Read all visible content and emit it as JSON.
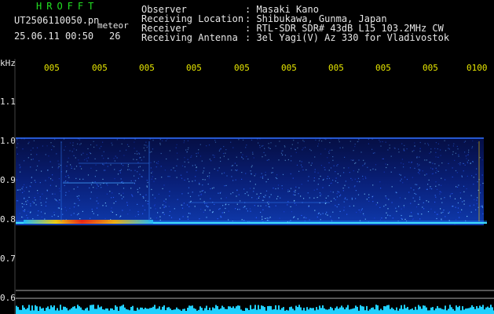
{
  "header": {
    "title": "HROFFT",
    "filename": "UT2506110050.pn",
    "meteor_label": "meteor",
    "datetime": "25.06.11 00:50",
    "count": "26"
  },
  "info": [
    {
      "key": "Observer",
      "value": ": Masaki Kano"
    },
    {
      "key": "Receiving Location",
      "value": ": Shibukawa, Gunma, Japan"
    },
    {
      "key": "Receiver",
      "value": ": RTL-SDR SDR# 43dB L15 103.2MHz CW"
    },
    {
      "key": "Receiving Antenna",
      "value": ": 3el Yagi(V) Az 330 for Vladivostok"
    }
  ],
  "axis": {
    "unit": "kHz",
    "y_labels": [
      "1.1",
      "1.0",
      "0.9",
      "0.8",
      "0.7",
      "0.6"
    ],
    "x_labels": [
      "005",
      "005",
      "005",
      "005",
      "005",
      "005",
      "005",
      "005",
      "005",
      "0100"
    ]
  },
  "colors": {
    "header_green": "#22e022",
    "text_white": "#e6e6e6",
    "tick_yellow": "#e6e600"
  }
}
